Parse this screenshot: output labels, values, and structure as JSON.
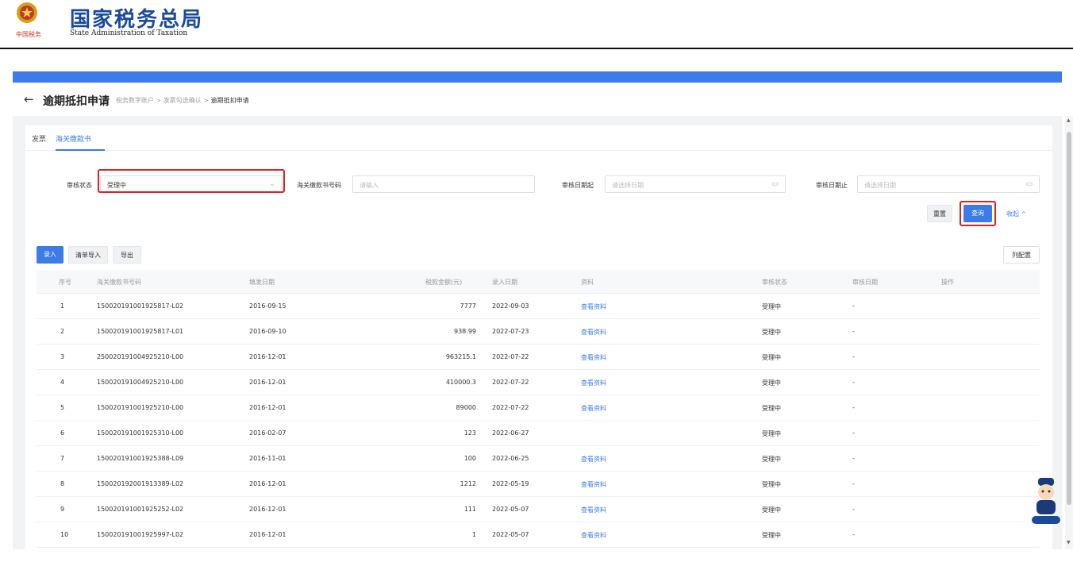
{
  "site": {
    "title": "国家税务总局",
    "subtitle": "State Administration of Taxation",
    "emblem_caption": "中国税务"
  },
  "page": {
    "back_icon": "back-arrow-icon",
    "title": "逾期抵扣申请",
    "breadcrumb": [
      {
        "label": "税务数字账户"
      },
      {
        "label": "发票勾选确认"
      },
      {
        "label": "逾期抵扣申请"
      }
    ],
    "breadcrumb_sep": ">"
  },
  "tabs": [
    {
      "label": "发票",
      "active": false
    },
    {
      "label": "海关缴款书",
      "active": true
    }
  ],
  "filters": {
    "status": {
      "label": "审核状态",
      "value": "受理中"
    },
    "number": {
      "label": "海关缴款书号码",
      "placeholder": "请输入"
    },
    "date_start": {
      "label": "审核日期起",
      "placeholder": "请选择日期"
    },
    "date_end": {
      "label": "审核日期止",
      "placeholder": "请选择日期"
    },
    "reset_label": "重置",
    "query_label": "查询",
    "collapse_label": "收起 ^"
  },
  "actions": {
    "entry_label": "录入",
    "import_label": "清单导入",
    "export_label": "导出",
    "column_config_label": "列配置"
  },
  "table": {
    "columns": [
      "序号",
      "海关缴款书号码",
      "填发日期",
      "税款金额(元)",
      "录入日期",
      "资料",
      "审核状态",
      "审核日期",
      "操作"
    ],
    "rows": [
      {
        "no": "1",
        "number": "150020191001925817-L02",
        "issue_date": "2016-09-15",
        "amount": "7777",
        "entry_date": "2022-09-03",
        "material": "查看资料",
        "status": "受理中",
        "review_date": "-"
      },
      {
        "no": "2",
        "number": "150020191001925817-L01",
        "issue_date": "2016-09-10",
        "amount": "938.99",
        "entry_date": "2022-07-23",
        "material": "查看资料",
        "status": "受理中",
        "review_date": "-"
      },
      {
        "no": "3",
        "number": "250020191004925210-L00",
        "issue_date": "2016-12-01",
        "amount": "963215.1",
        "entry_date": "2022-07-22",
        "material": "查看资料",
        "status": "受理中",
        "review_date": "-"
      },
      {
        "no": "4",
        "number": "150020191004925210-L00",
        "issue_date": "2016-12-01",
        "amount": "410000.3",
        "entry_date": "2022-07-22",
        "material": "查看资料",
        "status": "受理中",
        "review_date": "-"
      },
      {
        "no": "5",
        "number": "150020191001925210-L00",
        "issue_date": "2016-12-01",
        "amount": "89000",
        "entry_date": "2022-07-22",
        "material": "查看资料",
        "status": "受理中",
        "review_date": "-"
      },
      {
        "no": "6",
        "number": "150020191001925310-L00",
        "issue_date": "2016-02-07",
        "amount": "123",
        "entry_date": "2022-06-27",
        "material": "",
        "status": "受理中",
        "review_date": "-"
      },
      {
        "no": "7",
        "number": "150020191001925388-L09",
        "issue_date": "2016-11-01",
        "amount": "100",
        "entry_date": "2022-06-25",
        "material": "查看资料",
        "status": "受理中",
        "review_date": "-"
      },
      {
        "no": "8",
        "number": "150020192001913389-L02",
        "issue_date": "2016-12-01",
        "amount": "1212",
        "entry_date": "2022-05-19",
        "material": "查看资料",
        "status": "受理中",
        "review_date": "-"
      },
      {
        "no": "9",
        "number": "150020191001925252-L02",
        "issue_date": "2016-12-01",
        "amount": "111",
        "entry_date": "2022-05-07",
        "material": "查看资料",
        "status": "受理中",
        "review_date": "-"
      },
      {
        "no": "10",
        "number": "150020191001925997-L02",
        "issue_date": "2016-12-01",
        "amount": "1",
        "entry_date": "2022-05-07",
        "material": "查看资料",
        "status": "受理中",
        "review_date": "-"
      }
    ]
  },
  "icons": {
    "dropdown": "chevron-down-icon",
    "calendar": "calendar-icon"
  },
  "colors": {
    "accent": "#3c7be8",
    "brand": "#1a4a9c",
    "highlight": "#e02020"
  }
}
